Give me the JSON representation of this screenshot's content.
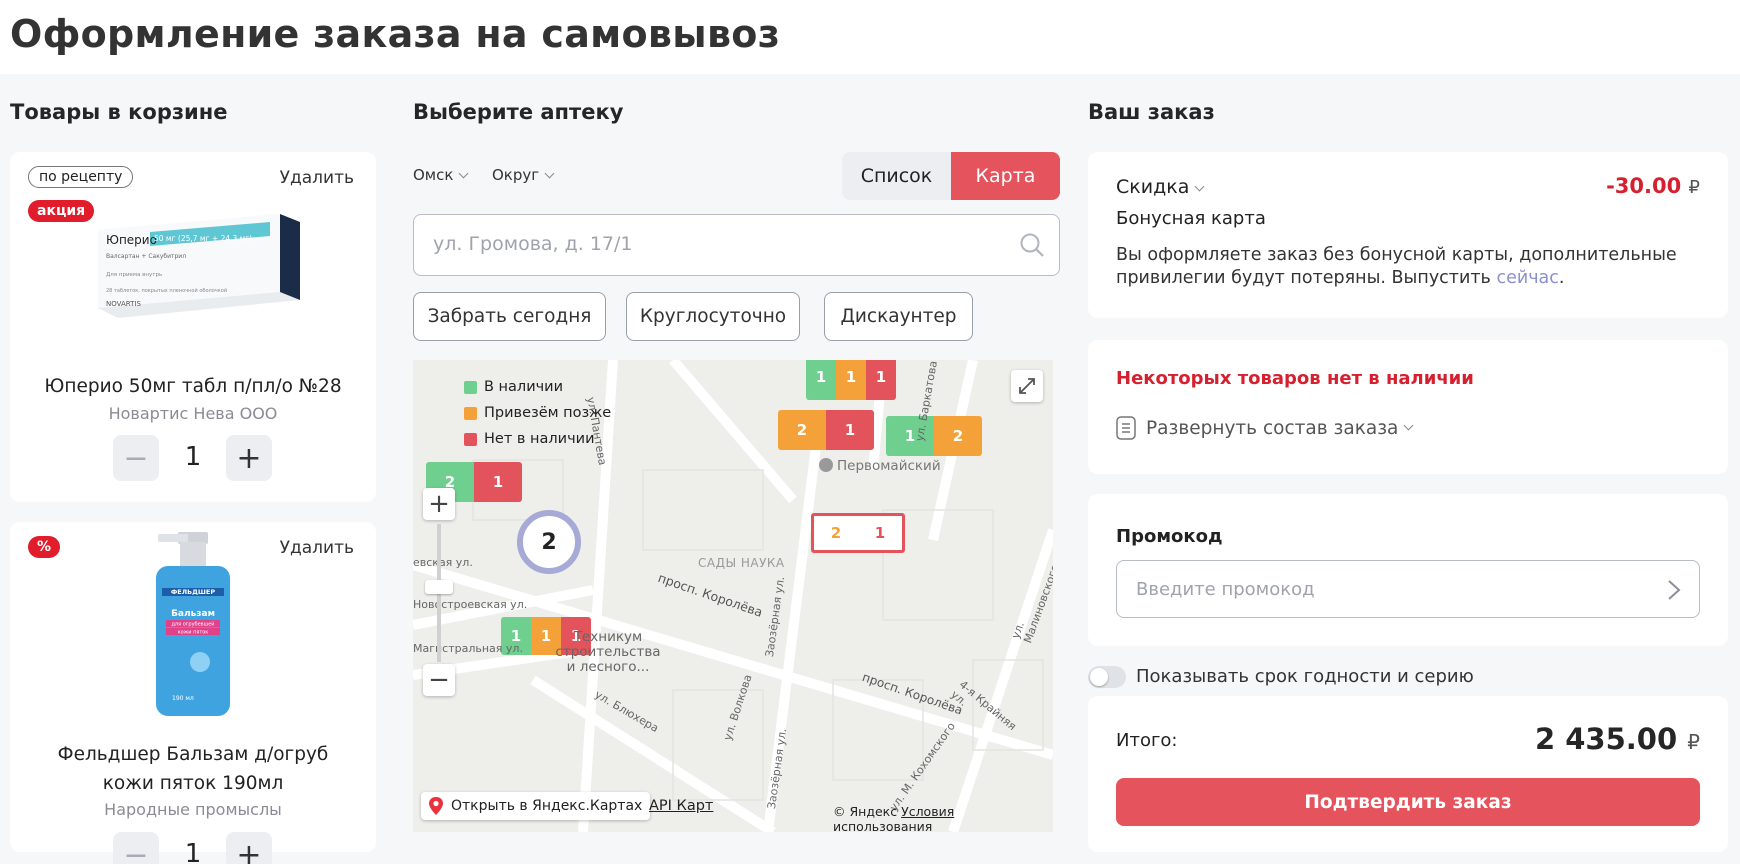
{
  "page": {
    "title": "Оформление заказа на самовывоз"
  },
  "cart": {
    "title": "Товары в корзине",
    "items": [
      {
        "rx_badge": "по рецепту",
        "promo_badge": "акция",
        "delete_label": "Удалить",
        "name": "Юперио 50мг табл п/пл/о №28",
        "maker": "Новартис Нева ООО",
        "quantity": "1",
        "package_text": {
          "brand": "Юперио",
          "dose": "50 мг (25,7 мг + 24,3 мг)",
          "ingredients": "Валсартан + Сакубитрил",
          "usage": "Для приема внутрь",
          "count": "28 таблеток, покрытых пленочной оболочкой",
          "company": "NOVARTIS"
        }
      },
      {
        "promo_badge": "%",
        "delete_label": "Удалить",
        "name": "Фельдшер Бальзам д/огруб кожи пяток 190мл",
        "maker": "Народные промыслы",
        "quantity": "1",
        "package_text": {
          "brand": "ФЕЛЬДШЕР",
          "type": "Бальзам",
          "purpose": "для огрубевшей",
          "area": "кожи пяток",
          "volume": "190 мл"
        }
      }
    ],
    "minus_symbol": "−",
    "plus_symbol": "+"
  },
  "pharmacy": {
    "title": "Выберите аптеку",
    "city": "Омск",
    "district": "Округ",
    "view_toggle": {
      "list": "Список",
      "map": "Карта",
      "active": "map"
    },
    "search_placeholder": "ул. Громова, д. 17/1",
    "filters": [
      "Забрать сегодня",
      "Круглосуточно",
      "Дискаунтер"
    ],
    "map": {
      "legend": [
        {
          "label": "В наличии",
          "color": "#6fcf8e"
        },
        {
          "label": "Привезём позже",
          "color": "#f4a13a"
        },
        {
          "label": "Нет в наличии",
          "color": "#e3535c"
        }
      ],
      "cluster_count": "2",
      "clusters": [
        {
          "values": [
            "2",
            "1"
          ],
          "colors": [
            "g",
            "r"
          ]
        },
        {
          "values": [
            "2",
            "1"
          ],
          "colors": [
            "o",
            "r"
          ]
        },
        {
          "values": [
            "1",
            "2"
          ],
          "colors": [
            "g",
            "o"
          ]
        },
        {
          "values": [
            "2",
            "1"
          ],
          "colors": [
            "o",
            "r"
          ]
        },
        {
          "values": [
            "1",
            "1",
            "1"
          ],
          "colors": [
            "g",
            "o",
            "r"
          ]
        },
        {
          "values": [
            "1",
            "1",
            "1"
          ],
          "colors": [
            "g",
            "o",
            "r"
          ]
        }
      ],
      "labels": {
        "district": "САДЫ НАУКА",
        "metro": "Первомайский",
        "college": "Техникум строительства и лесного...",
        "streets": [
          "ул. Пантева",
          "ул. Баркатова",
          "евская ул.",
          "Новостроевская ул.",
          "Магистральная ул.",
          "просп. Королёва",
          "Заозёрная ул.",
          "ул. Малиновского",
          "просп. Королёва",
          "4-я Крайняя ул.",
          "ул. Волкова",
          "ул. Блюхера",
          "Заозёрная ул.",
          "ул. М. Кохомского"
        ]
      },
      "zoom_in": "+",
      "zoom_out": "−",
      "open_in_yandex": "Открыть в Яндекс.Картах",
      "api_link": "API Карт",
      "copyright": "© Яндекс",
      "terms": "Условия использования"
    }
  },
  "order": {
    "title": "Ваш заказ",
    "discount_label": "Скидка",
    "discount_value": "-30.00",
    "currency": "₽",
    "bonus_title": "Бонусная карта",
    "bonus_text": "Вы оформляете заказ без бонусной карты, дополнительные привилегии будут потеряны. Выпустить",
    "bonus_link": "сейчас",
    "bonus_dot": ".",
    "unavailable_title": "Некоторых товаров нет в наличии",
    "expand_label": "Развернуть состав заказа",
    "promo_title": "Промокод",
    "promo_placeholder": "Введите промокод",
    "expiry_toggle_label": "Показывать срок годности и серию",
    "total_label": "Итого:",
    "total_value": "2 435.00",
    "confirm_label": "Подтвердить заказ"
  }
}
